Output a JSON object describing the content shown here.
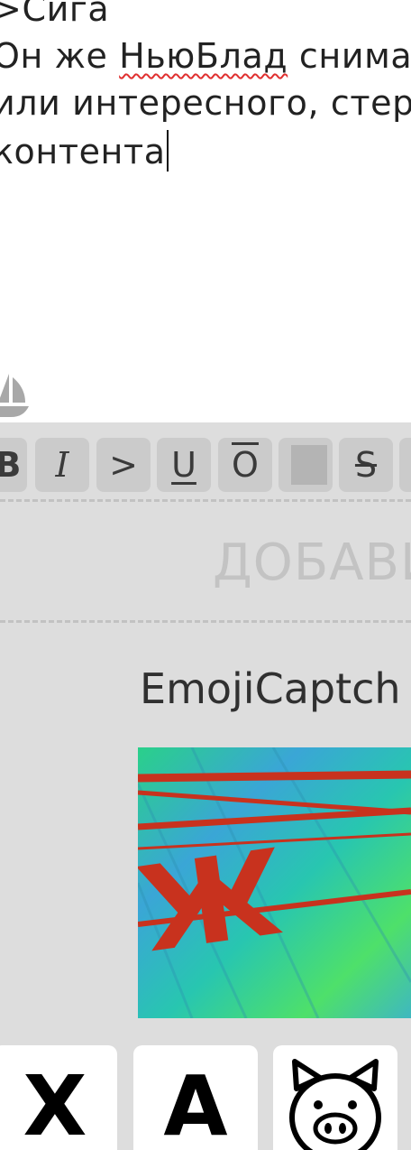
{
  "editor": {
    "lines": [
      ">Сига",
      "Он же ",
      "или интересного, стер",
      "контента"
    ],
    "misspelled_word": "НьюБлад",
    "line2_rest": " снима"
  },
  "toolbar": {
    "bold": "B",
    "italic": "I",
    "quote": ">",
    "underline": "U",
    "overline": "O",
    "spoiler": "",
    "strike": "S"
  },
  "dropzone": {
    "label": "ДОБАВИ"
  },
  "captcha": {
    "title": "EmojiCaptch",
    "image_text": "ЖА"
  },
  "emoji_answers": [
    {
      "label": "Х",
      "icon": ""
    },
    {
      "label": "A",
      "icon": ""
    },
    {
      "label": "",
      "icon": "pig-face-icon"
    }
  ]
}
